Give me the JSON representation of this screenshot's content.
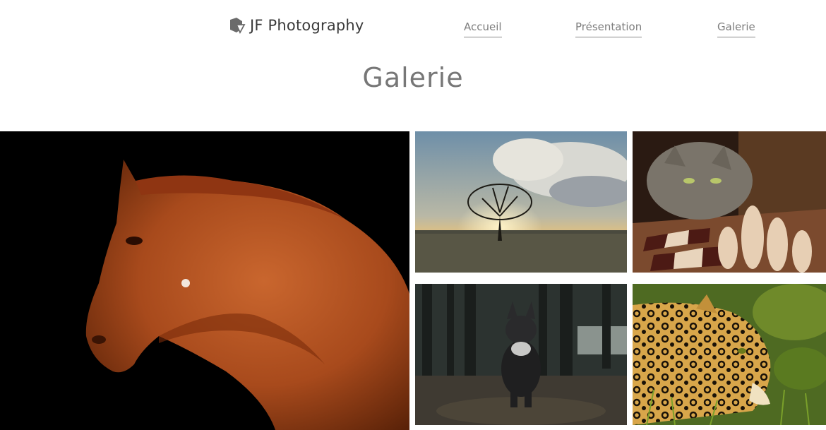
{
  "header": {
    "logo_text": "JF Photography",
    "logo_icon": "camera-logo-icon",
    "nav": [
      {
        "label": "Accueil"
      },
      {
        "label": "Présentation"
      },
      {
        "label": "Galerie"
      }
    ]
  },
  "main": {
    "title": "Galerie"
  },
  "gallery": {
    "photos": [
      {
        "subject": "horse"
      },
      {
        "subject": "tree-sunset"
      },
      {
        "subject": "cat-chess"
      },
      {
        "subject": "bulldog-forest"
      },
      {
        "subject": "jaguar"
      }
    ]
  },
  "colors": {
    "text": "#777777",
    "logo_text": "#3a3a3a",
    "nav_link": "#7d7d7d",
    "background": "#ffffff"
  }
}
